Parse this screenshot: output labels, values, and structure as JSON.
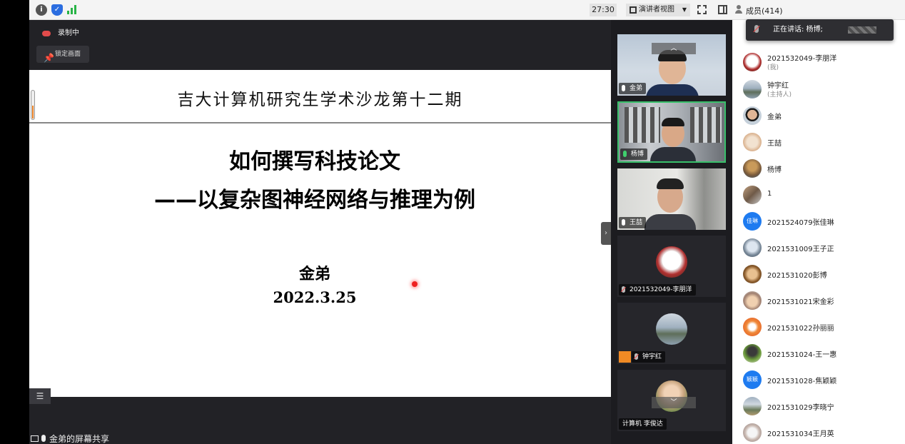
{
  "topbar": {
    "timer": "27:30",
    "presenter_view_label": "演讲者视图",
    "members_label": "成员(414)"
  },
  "main": {
    "recording_label": "录制中",
    "lock_label": "锁定画面",
    "share_label": "金弟的屏幕共享"
  },
  "slide": {
    "header": "吉大计算机研究生学术沙龙第十二期",
    "title_line1": "如何撰写科技论文",
    "title_line2": "——以复杂图神经网络与推理为例",
    "author": "金弟",
    "date": "2022.3.25"
  },
  "video_tiles": [
    {
      "name": "金弟"
    },
    {
      "name": "杨博"
    },
    {
      "name": "王喆"
    },
    {
      "name": "2021532049-李朋洋"
    },
    {
      "name": "钟宇红"
    },
    {
      "name": "计算机 李俊达"
    }
  ],
  "speaking": {
    "label": "正在讲话: 杨博;"
  },
  "participants": [
    {
      "name": "2021532049-李朋洋",
      "role": "(我)"
    },
    {
      "name": "钟宇红",
      "role": "(主持人)"
    },
    {
      "name": "金弟",
      "role": ""
    },
    {
      "name": "王喆",
      "role": ""
    },
    {
      "name": "杨博",
      "role": ""
    },
    {
      "name": "1",
      "role": ""
    },
    {
      "name": "2021524079张佳琳",
      "role": "",
      "avatar_text": "佳琳"
    },
    {
      "name": "2021531009王子正",
      "role": ""
    },
    {
      "name": "2021531020彭博",
      "role": ""
    },
    {
      "name": "2021531021宋金彩",
      "role": ""
    },
    {
      "name": "2021531022孙丽丽",
      "role": ""
    },
    {
      "name": "2021531024-王一惠",
      "role": ""
    },
    {
      "name": "2021531028-焦颖颖",
      "role": "",
      "avatar_text": "颖颖"
    },
    {
      "name": "2021531029李晓宁",
      "role": ""
    },
    {
      "name": "2021531034王月英",
      "role": ""
    }
  ],
  "colors": {
    "active_border": "#39c06b",
    "accent_blue": "#1e7bf0",
    "host_orange": "#f08a24"
  }
}
